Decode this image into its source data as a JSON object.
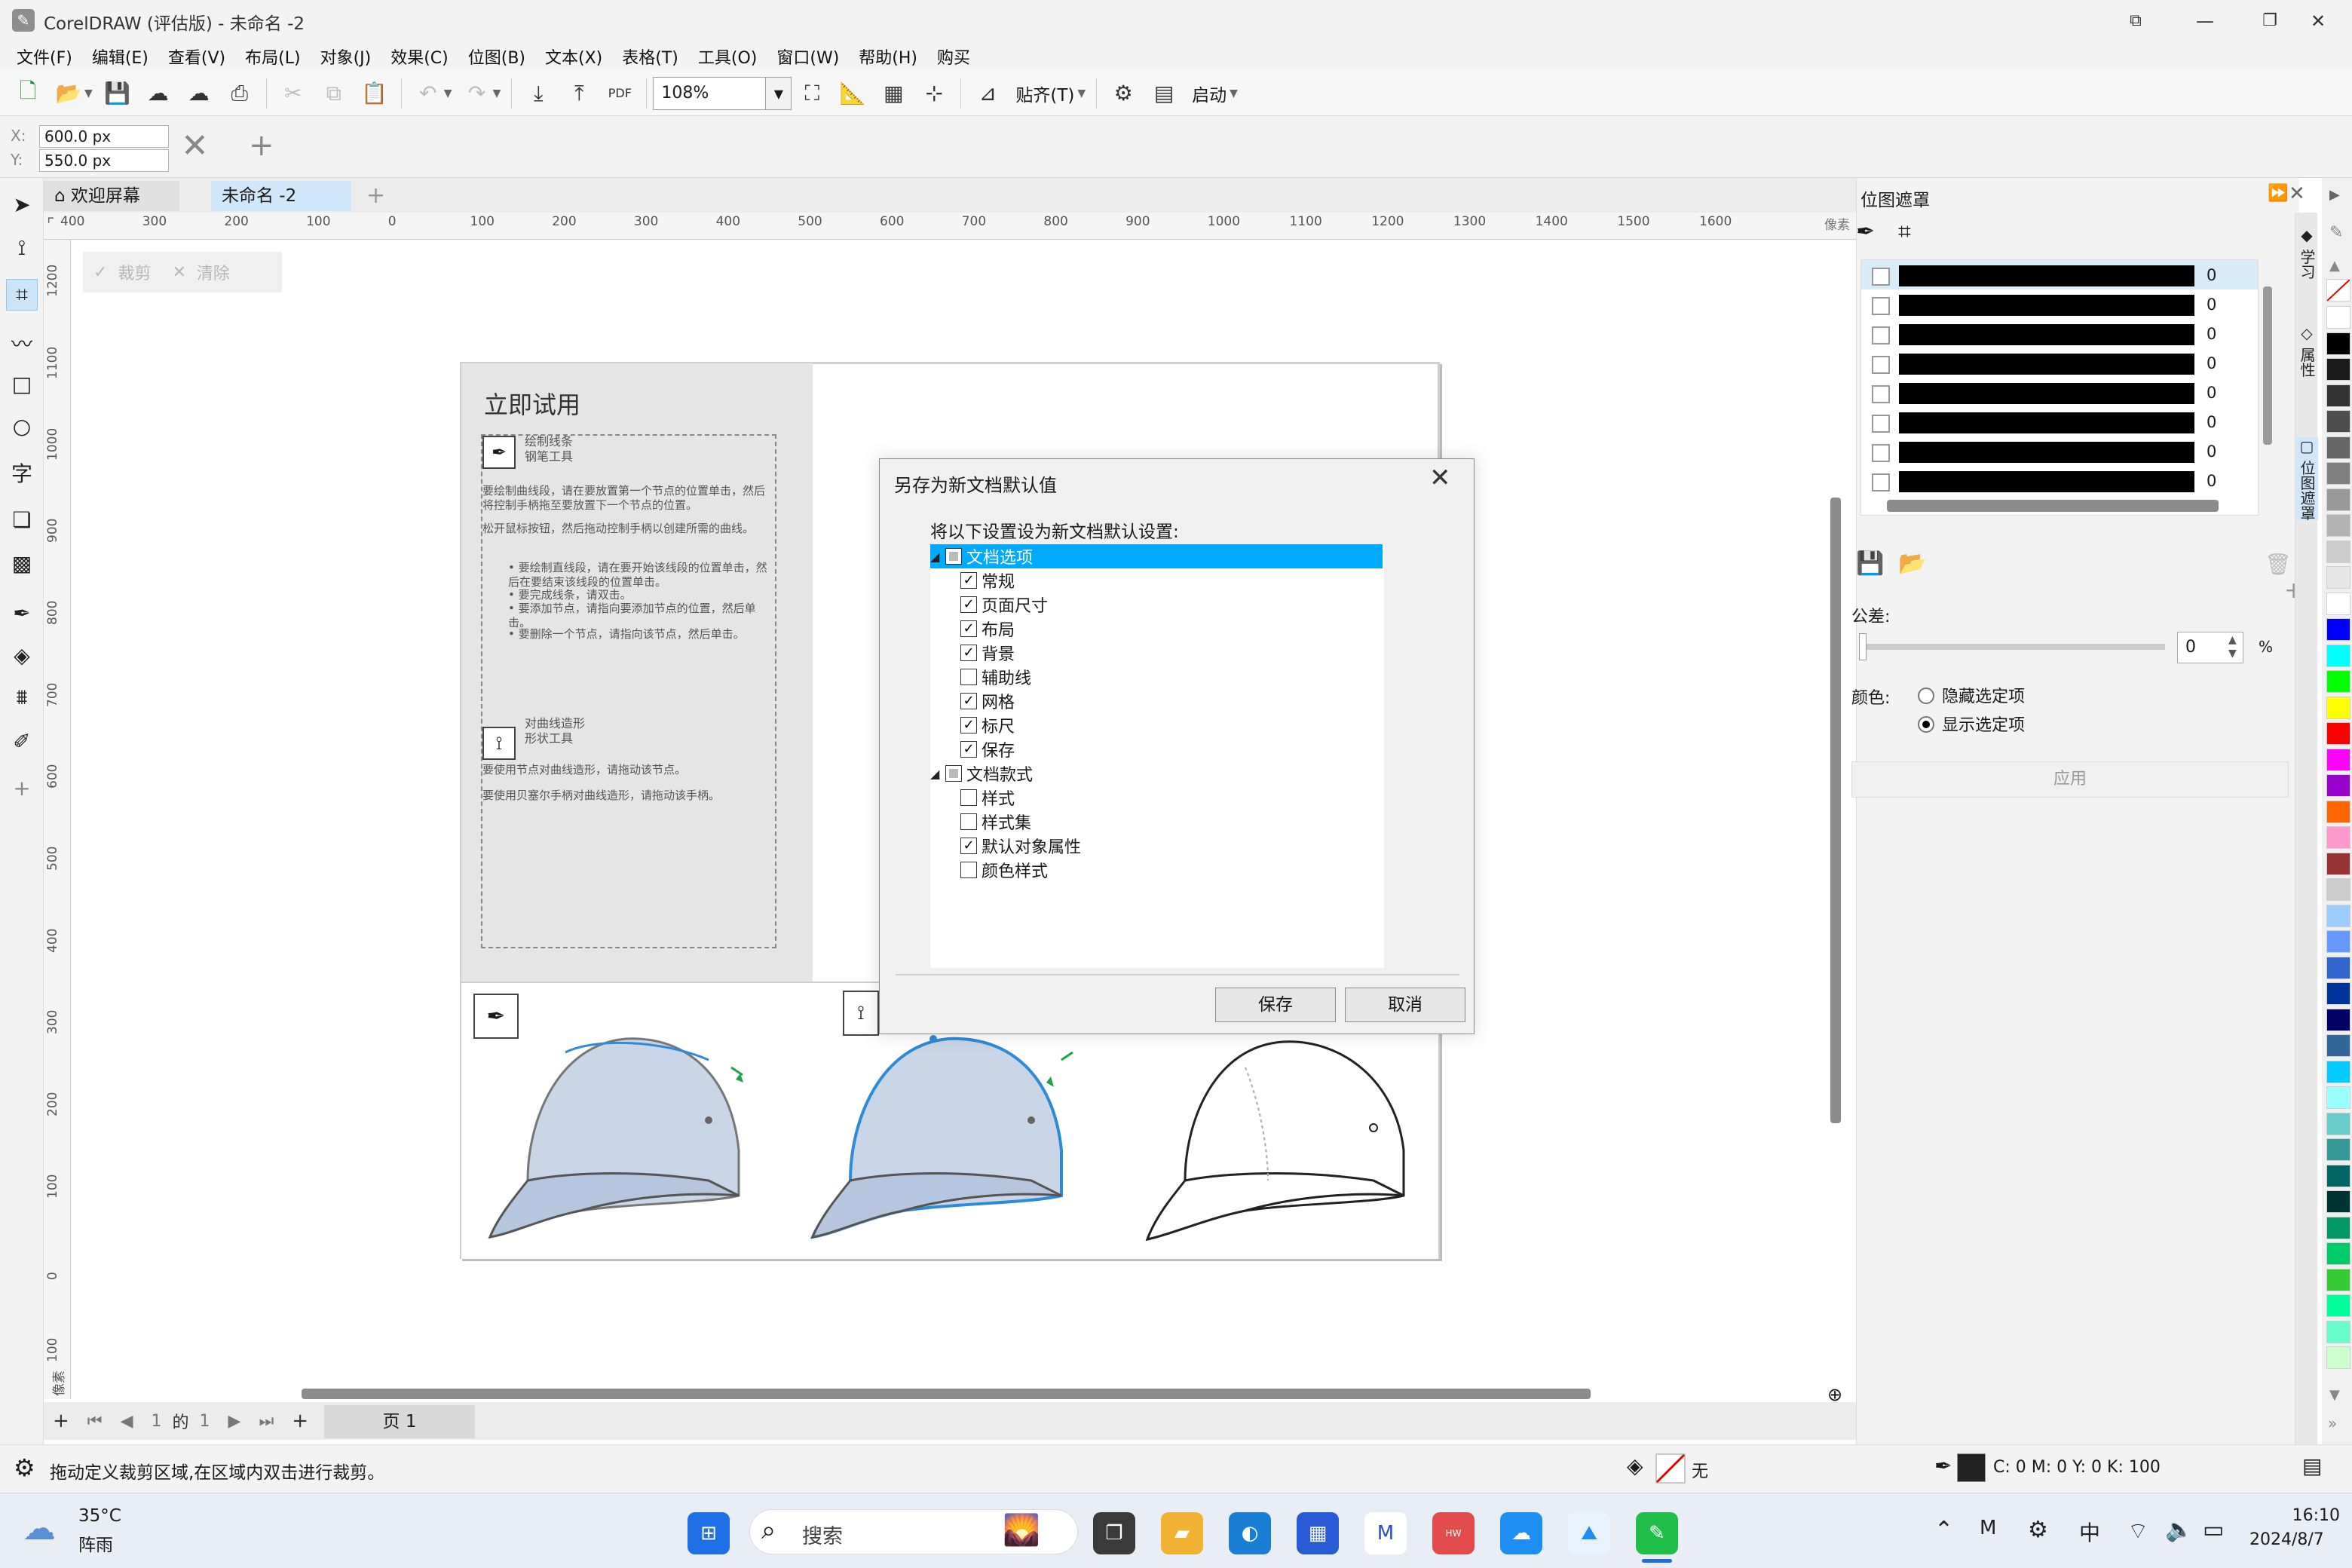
{
  "window": {
    "title": "CorelDRAW (评估版) - 未命名 -2",
    "logo": "logo-icon",
    "controls": [
      "restore-down-icon",
      "minimize-icon",
      "maximize-icon",
      "close-icon"
    ]
  },
  "menu": [
    "文件(F)",
    "编辑(E)",
    "查看(V)",
    "布局(L)",
    "对象(J)",
    "效果(C)",
    "位图(B)",
    "文本(X)",
    "表格(T)",
    "工具(O)",
    "窗口(W)",
    "帮助(H)",
    "购买"
  ],
  "toolbar": {
    "zoom": "108%",
    "snap_label": "贴齐(T)",
    "launch_label": "启动",
    "pdf_label": "PDF"
  },
  "propbar": {
    "x_label": "X:",
    "y_label": "Y:",
    "x_value": "600.0 px",
    "y_value": "550.0 px"
  },
  "tabs": {
    "welcome": "欢迎屏幕",
    "document": "未命名 -2"
  },
  "crop_bar": {
    "crop": "裁剪",
    "clear": "清除"
  },
  "ruler": {
    "h_ticks": [
      "400",
      "300",
      "200",
      "100",
      "0",
      "100",
      "200",
      "300",
      "400",
      "500",
      "600",
      "700",
      "800",
      "900",
      "1000",
      "1100",
      "1200",
      "1300",
      "1400",
      "1500",
      "1600"
    ],
    "h_unit": "像素",
    "v_ticks": [
      "1200",
      "1100",
      "1000",
      "900",
      "800",
      "700",
      "600",
      "500",
      "400",
      "300",
      "200",
      "100",
      "0",
      "100"
    ],
    "v_unit": "像素"
  },
  "page_content": {
    "title": "立即试用",
    "pen_tool_title_1": "绘制线条",
    "pen_tool_title_2": "钢笔工具",
    "pen_para_1": "要绘制曲线段，请在要放置第一个节点的位置单击，然后将控制手柄拖至要放置下一个节点的位置。",
    "pen_para_2": "松开鼠标按钮，然后拖动控制手柄以创建所需的曲线。",
    "pen_bullets": [
      "要绘制直线段，请在要开始该线段的位置单击，然后在要结束该线段的位置单击。",
      "要完成线条，请双击。",
      "要添加节点，请指向要添加节点的位置，然后单击。",
      "要删除一个节点，请指向该节点，然后单击。"
    ],
    "shape_tool_title_1": "对曲线造形",
    "shape_tool_title_2": "形状工具",
    "shape_para_1": "要使用节点对曲线造形，请拖动该节点。",
    "shape_para_2": "要使用贝塞尔手柄对曲线造形，请拖动该手柄。"
  },
  "page_nav": {
    "current": "1",
    "of": "的",
    "total": "1",
    "page_tab": "页 1"
  },
  "status": {
    "hint": "拖动定义裁剪区域,在区域内双击进行裁剪。",
    "fill_label": "无",
    "color_values": "C: 0 M: 0 Y: 0 K: 100"
  },
  "docker": {
    "title": "位图遮罩",
    "vertical_tabs": [
      "学习",
      "属性",
      "位图遮罩"
    ],
    "rows": [
      {
        "value": "0"
      },
      {
        "value": "0"
      },
      {
        "value": "0"
      },
      {
        "value": "0"
      },
      {
        "value": "0"
      },
      {
        "value": "0"
      },
      {
        "value": "0"
      },
      {
        "value": "0"
      }
    ],
    "tolerance_label": "公差:",
    "tolerance_value": "0",
    "tolerance_unit": "%",
    "color_label": "颜色:",
    "hide_selected": "隐藏选定项",
    "show_selected": "显示选定项",
    "apply": "应用"
  },
  "palette": [
    "#ffffff",
    "#000000",
    "#1a1a1a",
    "#333333",
    "#4d4d4d",
    "#666666",
    "#808080",
    "#999999",
    "#b3b3b3",
    "#cccccc",
    "#e6e6e6",
    "#ffffff",
    "#0000ff",
    "#00ffff",
    "#00ff00",
    "#ffff00",
    "#ff0000",
    "#ff00ff",
    "#9900cc",
    "#ff6600",
    "#ff99cc",
    "#993333",
    "#cccccc",
    "#99ccff",
    "#6699ff",
    "#3366cc",
    "#003399",
    "#000066",
    "#336699",
    "#00ccff",
    "#99ffff",
    "#66cccc",
    "#339999",
    "#006666",
    "#003333",
    "#009966",
    "#00cc66",
    "#33cc33",
    "#00ff99",
    "#66ffcc",
    "#ccffcc"
  ],
  "dialog": {
    "title": "另存为新文档默认值",
    "prompt": "将以下设置设为新文档默认设置:",
    "groups": [
      {
        "label": "文档选项",
        "selected": true,
        "items": [
          {
            "label": "常规",
            "checked": true
          },
          {
            "label": "页面尺寸",
            "checked": true
          },
          {
            "label": "布局",
            "checked": true
          },
          {
            "label": "背景",
            "checked": true
          },
          {
            "label": "辅助线",
            "checked": false
          },
          {
            "label": "网格",
            "checked": true
          },
          {
            "label": "标尺",
            "checked": true
          },
          {
            "label": "保存",
            "checked": true
          }
        ]
      },
      {
        "label": "文档款式",
        "selected": false,
        "items": [
          {
            "label": "样式",
            "checked": false
          },
          {
            "label": "样式集",
            "checked": false
          },
          {
            "label": "默认对象属性",
            "checked": true
          },
          {
            "label": "颜色样式",
            "checked": false
          }
        ]
      }
    ],
    "save": "保存",
    "cancel": "取消"
  },
  "taskbar": {
    "temperature": "35°C",
    "weather": "阵雨",
    "search_placeholder": "搜索",
    "time": "16:10",
    "date": "2024/8/7",
    "ime": "中"
  }
}
